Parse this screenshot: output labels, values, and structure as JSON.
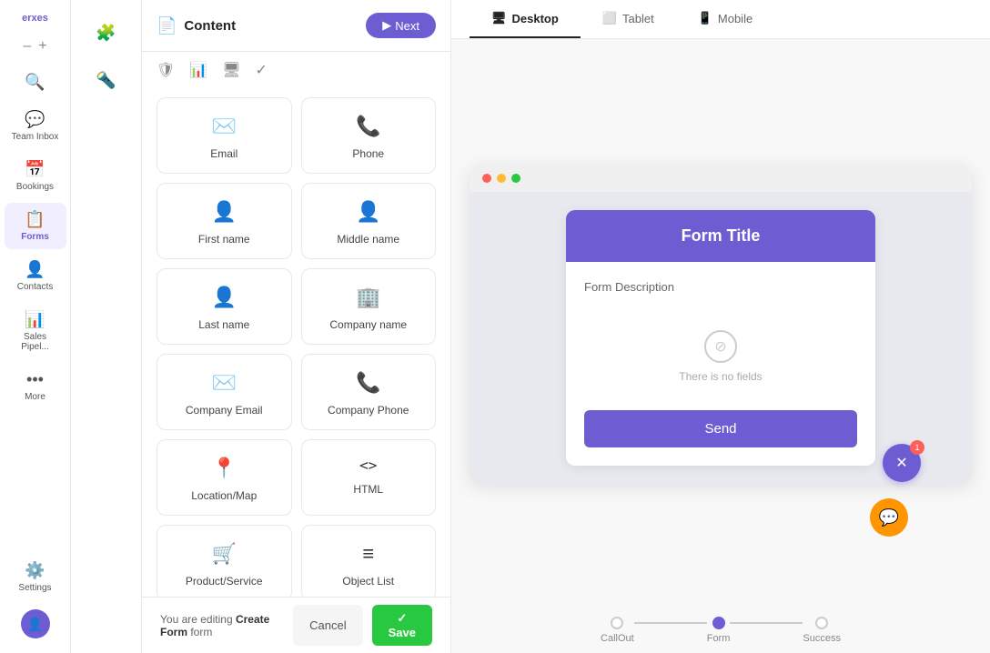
{
  "app": {
    "name": "erxes",
    "page_title": "Forms"
  },
  "sidebar": {
    "items": [
      {
        "id": "search",
        "icon": "🔍",
        "label": ""
      },
      {
        "id": "team-inbox",
        "icon": "💬",
        "label": "Team Inbox"
      },
      {
        "id": "bookings",
        "icon": "📅",
        "label": "Bookings"
      },
      {
        "id": "forms",
        "icon": "📋",
        "label": "Forms",
        "active": true
      },
      {
        "id": "contacts",
        "icon": "👤",
        "label": "Contacts"
      },
      {
        "id": "sales-pipeline",
        "icon": "📊",
        "label": "Sales Pipel..."
      },
      {
        "id": "more",
        "icon": "•••",
        "label": "More"
      },
      {
        "id": "settings",
        "icon": "⚙️",
        "label": "Settings"
      }
    ]
  },
  "content_panel": {
    "title": "Content",
    "next_button": "Next",
    "fields": [
      {
        "id": "email",
        "icon": "✉️",
        "label": "Email"
      },
      {
        "id": "phone",
        "icon": "📞",
        "label": "Phone"
      },
      {
        "id": "first-name",
        "icon": "👤",
        "label": "First name"
      },
      {
        "id": "middle-name",
        "icon": "👤",
        "label": "Middle name"
      },
      {
        "id": "last-name",
        "icon": "👤",
        "label": "Last name"
      },
      {
        "id": "company-name",
        "icon": "🏢",
        "label": "Company name"
      },
      {
        "id": "company-email",
        "icon": "✉️",
        "label": "Company Email"
      },
      {
        "id": "company-phone",
        "icon": "📞",
        "label": "Company Phone"
      },
      {
        "id": "location-map",
        "icon": "📍",
        "label": "Location/Map"
      },
      {
        "id": "html",
        "icon": "<>",
        "label": "HTML"
      },
      {
        "id": "product-service",
        "icon": "🛒",
        "label": "Product/Service"
      },
      {
        "id": "object-list",
        "icon": "≡",
        "label": "Object List"
      }
    ]
  },
  "preview": {
    "tabs": [
      {
        "id": "desktop",
        "label": "Desktop",
        "icon": "🖥",
        "active": true
      },
      {
        "id": "tablet",
        "label": "Tablet",
        "icon": "📱"
      },
      {
        "id": "mobile",
        "label": "Mobile",
        "icon": "📱"
      }
    ],
    "form": {
      "title": "Form Title",
      "description": "Form Description",
      "no_fields_text": "There is no fields",
      "send_button": "Send"
    }
  },
  "bottom_bar": {
    "status_text": "You are editing ",
    "form_name": "Create Form",
    "form_suffix": " form",
    "cancel_label": "Cancel",
    "save_label": "Save"
  },
  "progress_steps": [
    {
      "id": "callout",
      "label": "CallOut",
      "active": false
    },
    {
      "id": "form",
      "label": "Form",
      "active": true
    },
    {
      "id": "success",
      "label": "Success",
      "active": false
    }
  ],
  "colors": {
    "primary": "#6c5dd3",
    "success": "#28c840",
    "danger": "#ff5f57"
  }
}
